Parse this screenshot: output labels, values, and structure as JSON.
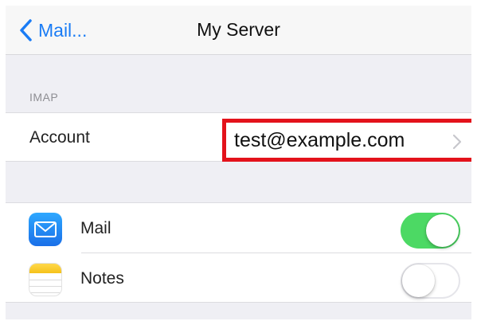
{
  "nav": {
    "back_label": "Mail...",
    "title": "My Server"
  },
  "imap": {
    "section_header": "IMAP",
    "account_label": "Account",
    "account_value": "test@example.com"
  },
  "apps": [
    {
      "label": "Mail",
      "icon": "mail-icon",
      "enabled": true
    },
    {
      "label": "Notes",
      "icon": "notes-icon",
      "enabled": false
    }
  ],
  "colors": {
    "accent": "#1a7cf5",
    "toggle_on": "#4cd964",
    "highlight": "#e3121b"
  }
}
